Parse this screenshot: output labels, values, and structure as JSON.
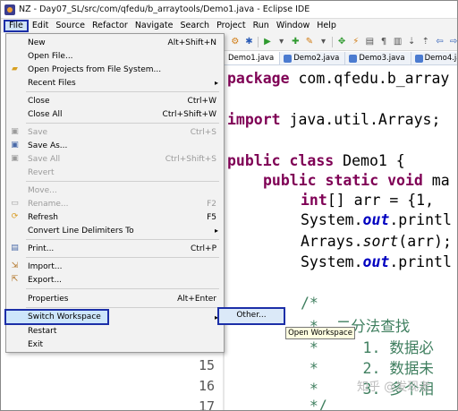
{
  "window": {
    "title": "NZ - Day07_SL/src/com/qfedu/b_arraytools/Demo1.java - Eclipse IDE"
  },
  "menubar": [
    "File",
    "Edit",
    "Source",
    "Refactor",
    "Navigate",
    "Search",
    "Project",
    "Run",
    "Window",
    "Help"
  ],
  "tabs": [
    "Demo1.java",
    "Demo2.java",
    "Demo3.java",
    "Demo4.java"
  ],
  "file_menu": {
    "items": [
      {
        "label": "New",
        "shortcut": "Alt+Shift+N",
        "arrow": "▸",
        "icon": ""
      },
      {
        "label": "Open File...",
        "shortcut": "",
        "icon": ""
      },
      {
        "label": "Open Projects from File System...",
        "shortcut": "",
        "icon": "folder-icon"
      },
      {
        "label": "Recent Files",
        "shortcut": "",
        "arrow": "▸",
        "icon": ""
      },
      {
        "label": "Close",
        "shortcut": "Ctrl+W",
        "icon": ""
      },
      {
        "label": "Close All",
        "shortcut": "Ctrl+Shift+W",
        "icon": ""
      },
      {
        "label": "Save",
        "shortcut": "Ctrl+S",
        "icon": "save-icon",
        "disabled": true
      },
      {
        "label": "Save As...",
        "shortcut": "",
        "icon": "save-as-icon"
      },
      {
        "label": "Save All",
        "shortcut": "Ctrl+Shift+S",
        "icon": "save-all-icon",
        "disabled": true
      },
      {
        "label": "Revert",
        "shortcut": "",
        "icon": "",
        "disabled": true
      },
      {
        "label": "Move...",
        "shortcut": "",
        "icon": "",
        "disabled": true
      },
      {
        "label": "Rename...",
        "shortcut": "F2",
        "icon": "rename-icon",
        "disabled": true
      },
      {
        "label": "Refresh",
        "shortcut": "F5",
        "icon": "refresh-icon"
      },
      {
        "label": "Convert Line Delimiters To",
        "shortcut": "",
        "arrow": "▸",
        "icon": ""
      },
      {
        "label": "Print...",
        "shortcut": "Ctrl+P",
        "icon": "print-icon"
      },
      {
        "label": "Import...",
        "shortcut": "",
        "icon": "import-icon"
      },
      {
        "label": "Export...",
        "shortcut": "",
        "icon": "export-icon"
      },
      {
        "label": "Properties",
        "shortcut": "Alt+Enter",
        "icon": ""
      },
      {
        "label": "Switch Workspace",
        "shortcut": "",
        "arrow": "▸",
        "icon": ""
      },
      {
        "label": "Restart",
        "shortcut": "",
        "icon": ""
      },
      {
        "label": "Exit",
        "shortcut": "",
        "icon": ""
      }
    ]
  },
  "submenu": {
    "label": "Other..."
  },
  "tooltip": "Open Workspace",
  "code": {
    "line_numbers": [
      "15",
      "16",
      "17"
    ],
    "lines": {
      "package": "package com.qfedu.b_array",
      "import": "import java.util.Arrays;",
      "class_kw1": "public",
      "class_kw2": "class",
      "class_rest": " Demo1 {",
      "main_kw1": "public",
      "main_kw2": "static",
      "main_kw3": "void",
      "main_rest": " ma",
      "arr_kw": "int",
      "arr_rest": "[] arr = {1, ",
      "sys1_a": "System.",
      "sys1_field": "out",
      "sys1_b": ".printl",
      "sort_a": "Arrays.",
      "sort_meth": "sort",
      "sort_b": "(arr);",
      "sys2_a": "System.",
      "sys2_field": "out",
      "sys2_b": ".printl",
      "c1": "/*",
      "c2": " *  二分法查找",
      "c3": " *     1. 数据必",
      "c4": " *     2. 数据未",
      "c5": " *     3. 多个相",
      "c6": " */"
    }
  },
  "watermark": "知乎 @发现者"
}
